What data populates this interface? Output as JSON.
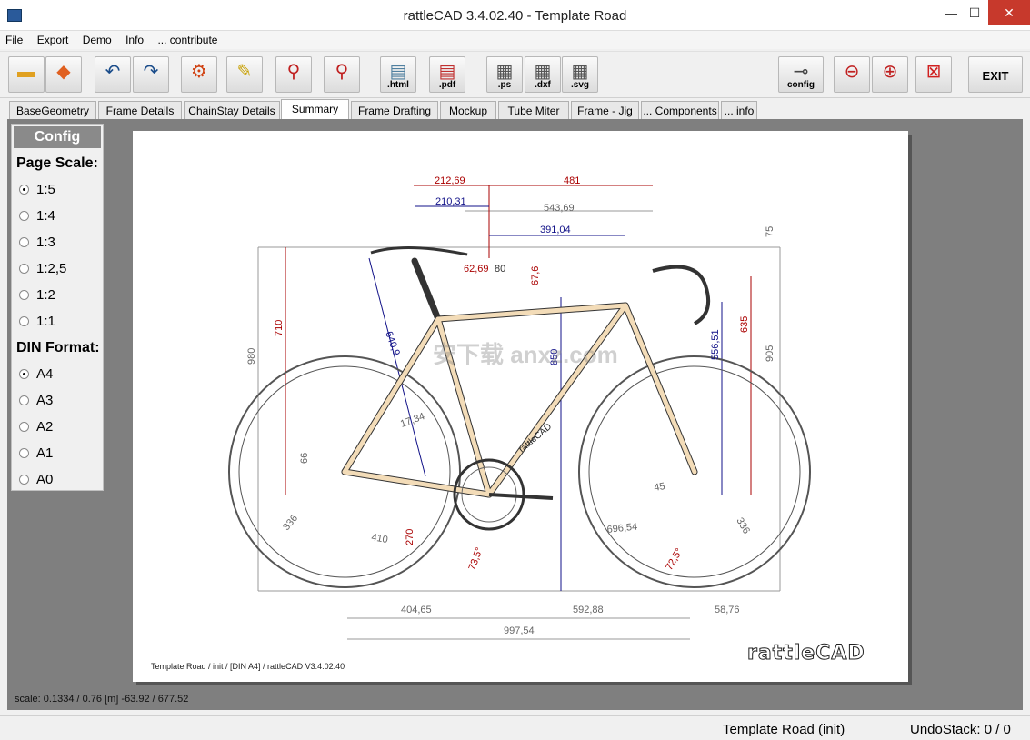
{
  "window": {
    "title": "rattleCAD  3.4.02.40 - Template Road",
    "minimize": "—",
    "maximize": "☐",
    "close": "✕"
  },
  "menu": [
    "File",
    "Export",
    "Demo",
    "Info",
    "... contribute"
  ],
  "toolbar": {
    "html": ".html",
    "pdf": ".pdf",
    "ps": ".ps",
    "dxf": ".dxf",
    "svg": ".svg",
    "config": "config",
    "exit": "EXIT"
  },
  "tabs": [
    "BaseGeometry",
    "Frame Details",
    "ChainStay Details",
    "Summary",
    "Frame Drafting",
    "Mockup",
    "Tube Miter",
    "Frame - Jig",
    "... Components",
    "... info"
  ],
  "active_tab": "Summary",
  "config": {
    "title": "Config",
    "page_scale_label": "Page Scale:",
    "page_scales": [
      "1:5",
      "1:4",
      "1:3",
      "1:2,5",
      "1:2",
      "1:1"
    ],
    "page_scale_selected": "1:5",
    "din_label": "DIN Format:",
    "din_formats": [
      "A4",
      "A3",
      "A2",
      "A1",
      "A0"
    ],
    "din_selected": "A4"
  },
  "drawing": {
    "dims_red": [
      "212,69",
      "481",
      "62,69",
      "80",
      "67,6",
      "710",
      "635",
      "73,5°",
      "72,5°"
    ],
    "dims_blue": [
      "210,31",
      "391,04",
      "640,9",
      "556,51",
      "850"
    ],
    "dims_gray": [
      "543,69",
      "75",
      "980",
      "905",
      "17,34",
      "66",
      "336",
      "410",
      "270",
      "45",
      "696,54",
      "336"
    ],
    "dims_bottom": [
      "404,65",
      "592,88",
      "58,76",
      "997,54"
    ],
    "footer_note": "Template Road   /   init   /  [DIN A4]  /   rattleCAD   V3.4.02.40",
    "logo": "rattleCAD",
    "down_tube_text": "rattleCAD"
  },
  "watermark": "安下载 anxz.com",
  "scale_readout": "scale: 0.1334 / 0.76  [m]  -63.92 / 677.52",
  "status": {
    "project": "Template Road (init)",
    "undo": "UndoStack:  0 /  0"
  }
}
